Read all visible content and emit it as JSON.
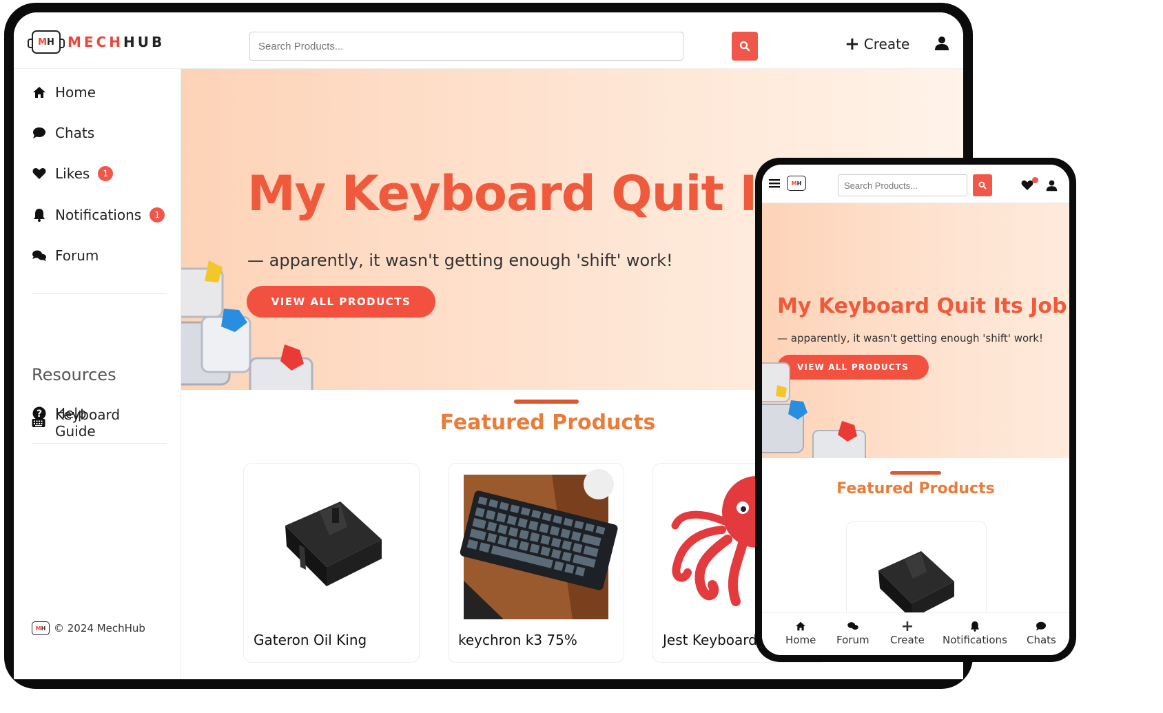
{
  "brand": {
    "mark_m": "M",
    "mark_h": "H",
    "name_part1": "MECH",
    "name_part2": "HUB"
  },
  "header": {
    "search_placeholder": "Search Products...",
    "create_label": "Create"
  },
  "sidebar": {
    "items": [
      {
        "label": "Home",
        "icon": "home-icon"
      },
      {
        "label": "Chats",
        "icon": "chat-icon"
      },
      {
        "label": "Likes",
        "icon": "heart-icon",
        "badge": "1"
      },
      {
        "label": "Notifications",
        "icon": "bell-icon",
        "badge": "1"
      },
      {
        "label": "Forum",
        "icon": "forum-icon"
      }
    ],
    "resources_heading": "Resources",
    "resources": [
      {
        "label": "Keyboard Guide",
        "icon": "keyboard-icon"
      },
      {
        "label": "Help",
        "icon": "help-icon"
      }
    ],
    "copyright": "© 2024 MechHub"
  },
  "hero": {
    "title": "My Keyboard Quit Its Job",
    "subtitle": "— apparently, it wasn't getting enough 'shift' work!",
    "button_label": "VIEW ALL PRODUCTS"
  },
  "featured": {
    "title": "Featured Products",
    "products": [
      {
        "name": "Gateron Oil King"
      },
      {
        "name": "keychron k3 75%"
      },
      {
        "name": "Jest Keyboard"
      }
    ]
  },
  "mobile": {
    "search_placeholder": "Search Products...",
    "hero_title": "My Keyboard Quit Its Job",
    "hero_subtitle": "— apparently, it wasn't getting enough 'shift' work!",
    "hero_button": "VIEW ALL PRODUCTS",
    "featured_title": "Featured Products",
    "bottom_nav": [
      {
        "label": "Home",
        "icon": "home-icon"
      },
      {
        "label": "Forum",
        "icon": "forum-icon"
      },
      {
        "label": "Create",
        "icon": "plus-icon"
      },
      {
        "label": "Notifications",
        "icon": "bell-icon"
      },
      {
        "label": "Chats",
        "icon": "chat-icon"
      }
    ]
  },
  "colors": {
    "accent": "#f0564a",
    "featured": "#ea7c3a",
    "hero_title": "#ef5a3c"
  }
}
